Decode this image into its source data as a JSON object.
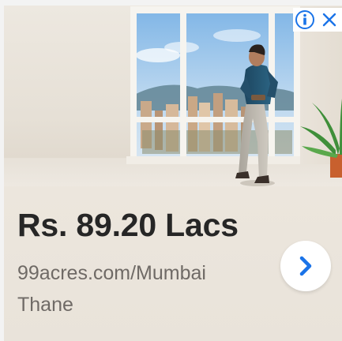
{
  "ad": {
    "price": "Rs. 89.20 Lacs",
    "domain": "99acres.com/Mumbai",
    "location": "Thane",
    "cta_icon": "chevron-right-icon",
    "info_icon": "info-icon",
    "close_icon": "close-icon",
    "colors": {
      "price_text": "#262626",
      "sub_text": "#6f6a66",
      "accent": "#1a73e8",
      "background": "#ece7df"
    }
  }
}
